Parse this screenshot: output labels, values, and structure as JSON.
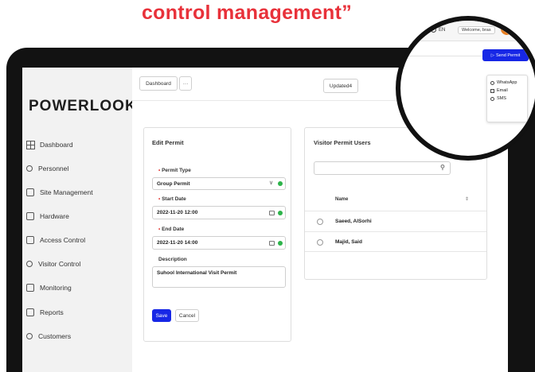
{
  "heading": "control management”",
  "brand": {
    "logo": "POWERLOOK"
  },
  "sidebar": {
    "items": [
      {
        "label": "Dashboard",
        "icon": "grid-icon"
      },
      {
        "label": "Personnel",
        "icon": "person-icon"
      },
      {
        "label": "Site Management",
        "icon": "site-icon"
      },
      {
        "label": "Hardware",
        "icon": "hardware-icon"
      },
      {
        "label": "Access Control",
        "icon": "access-icon"
      },
      {
        "label": "Visitor Control",
        "icon": "visitor-icon"
      },
      {
        "label": "Monitoring",
        "icon": "monitor-icon"
      },
      {
        "label": "Reports",
        "icon": "report-icon"
      },
      {
        "label": "Customers",
        "icon": "customers-icon"
      }
    ]
  },
  "toolbar": {
    "breadcrumb": "Dashboard",
    "more": "···",
    "updated": "Updated4"
  },
  "edit_permit": {
    "title": "Edit Permit",
    "permit_type_label": "Permit Type",
    "permit_type_value": "Group Permit",
    "start_label": "Start Date",
    "start_value": "2022-11-20 12:00",
    "end_label": "End Date",
    "end_value": "2022-11-20 14:00",
    "description_label": "Description",
    "description_value": "Suhool International Visit Permit",
    "save": "Save",
    "cancel": "Cancel",
    "required_mark": "•"
  },
  "visitor_users": {
    "title": "Visitor Permit Users",
    "search_placeholder": "",
    "column_name": "Name",
    "sort_icon": "⇕",
    "rows": [
      {
        "name": "Saeed, AlSorhi"
      },
      {
        "name": "Majid, Said"
      }
    ]
  },
  "magnifier": {
    "language": "EN",
    "welcome": "Welcome, bras",
    "send_permit": "Send Permit",
    "send_icon": "▷",
    "share_options": [
      {
        "label": "WhatsApp",
        "icon": "whatsapp-icon"
      },
      {
        "label": "Email",
        "icon": "email-icon"
      },
      {
        "label": "SMS",
        "icon": "sms-icon"
      }
    ]
  },
  "colors": {
    "heading": "#e8313a",
    "primary": "#1727e6",
    "success": "#2db34a"
  }
}
